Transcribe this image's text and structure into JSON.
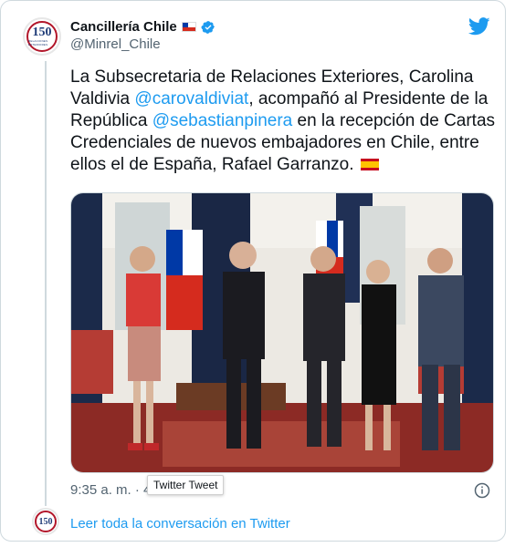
{
  "account": {
    "name": "Cancillería Chile",
    "handle": "@Minrel_Chile",
    "avatar_number": "150",
    "avatar_subtext": "RELACIONES EXTERIORES"
  },
  "tweet": {
    "text_part1": "La Subsecretaria de Relaciones Exteriores, Carolina Valdivia ",
    "mention1": "@carovaldiviat",
    "text_part2": ", acompañó al Presidente de la República ",
    "mention2": "@sebastianpinera",
    "text_part3": " en la recepción de Cartas Credenciales de nuevos embajadores en Chile, entre ellos el de España, Rafael Garranzo. "
  },
  "meta": {
    "timestamp": "9:35 a. m. · 4 ene. 2022",
    "tooltip": "Twitter Tweet"
  },
  "footer": {
    "link_label": "Leer toda la conversación en Twitter"
  },
  "colors": {
    "link": "#1d9bf0",
    "secondary": "#536471",
    "border": "#cfd9de"
  },
  "icons": [
    "chile-flag-icon",
    "verified-icon",
    "twitter-logo-icon",
    "spain-flag-icon",
    "info-icon"
  ]
}
